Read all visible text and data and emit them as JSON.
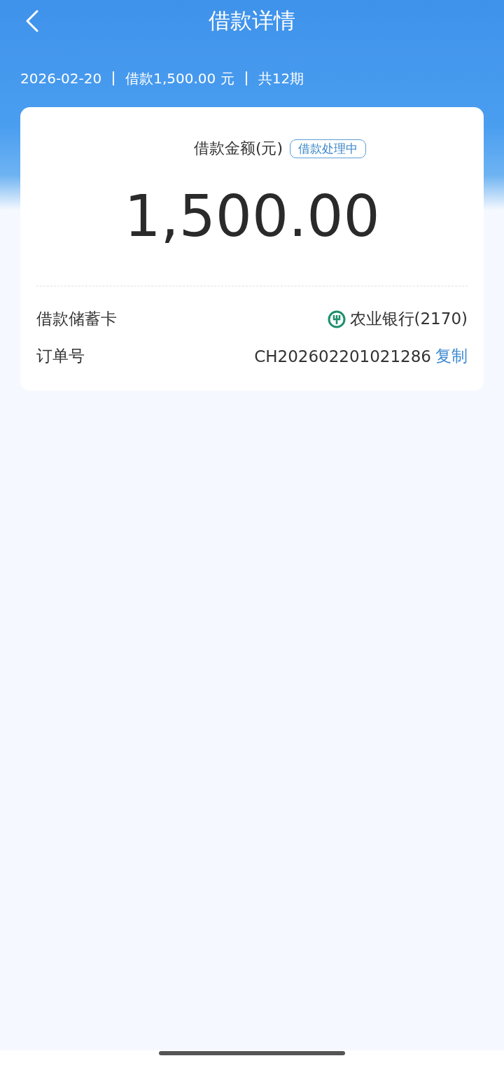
{
  "header": {
    "title": "借款详情"
  },
  "summary": [
    "2026-02-20",
    "借款1,500.00 元",
    "共12期"
  ],
  "card": {
    "amount_label": "借款金额(元)",
    "status_badge": "借款处理中",
    "amount": "1,500.00",
    "rows": [
      {
        "kind": "bank",
        "label": "借款储蓄卡",
        "value": "农业银行(2170)"
      },
      {
        "kind": "order",
        "label": "订单号",
        "value": "CH202602201021286",
        "action": "复制"
      }
    ]
  }
}
